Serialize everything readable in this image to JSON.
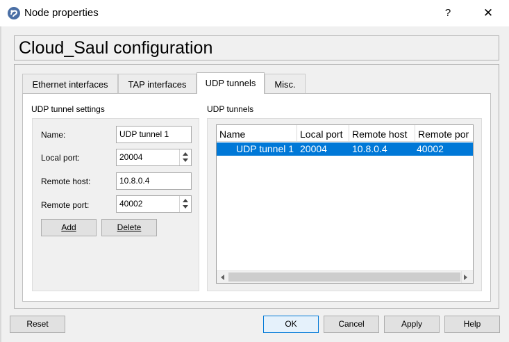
{
  "window": {
    "title": "Node properties",
    "help_label": "?",
    "close_label": "✕"
  },
  "config_title": "Cloud_Saul configuration",
  "tabs": [
    {
      "label": "Ethernet interfaces",
      "active": false
    },
    {
      "label": "TAP interfaces",
      "active": false
    },
    {
      "label": "UDP tunnels",
      "active": true
    },
    {
      "label": "Misc.",
      "active": false
    }
  ],
  "settings": {
    "group_title": "UDP tunnel settings",
    "name_label": "Name:",
    "name_value": "UDP tunnel 1",
    "local_port_label": "Local port:",
    "local_port_value": "20004",
    "remote_host_label": "Remote host:",
    "remote_host_value": "10.8.0.4",
    "remote_port_label": "Remote port:",
    "remote_port_value": "40002",
    "add_label": "Add",
    "delete_label": "Delete"
  },
  "tunnels": {
    "group_title": "UDP tunnels",
    "columns": [
      "Name",
      "Local port",
      "Remote host",
      "Remote por"
    ],
    "rows": [
      {
        "name": "UDP tunnel 1",
        "local_port": "20004",
        "remote_host": "10.8.0.4",
        "remote_port": "40002",
        "selected": true
      }
    ]
  },
  "footer": {
    "reset_label": "Reset",
    "ok_label": "OK",
    "cancel_label": "Cancel",
    "apply_label": "Apply",
    "help_label": "Help"
  },
  "colors": {
    "selection": "#0078d7",
    "window_bg": "#f0f0f0",
    "default_button_border": "#0078d7"
  }
}
